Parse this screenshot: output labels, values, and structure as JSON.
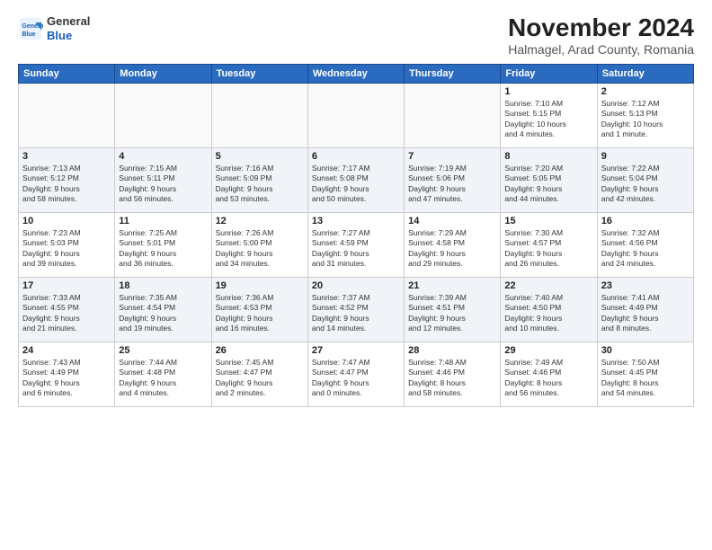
{
  "header": {
    "logo_line1": "General",
    "logo_line2": "Blue",
    "title": "November 2024",
    "subtitle": "Halmagel, Arad County, Romania"
  },
  "weekdays": [
    "Sunday",
    "Monday",
    "Tuesday",
    "Wednesday",
    "Thursday",
    "Friday",
    "Saturday"
  ],
  "weeks": [
    [
      {
        "day": "",
        "info": ""
      },
      {
        "day": "",
        "info": ""
      },
      {
        "day": "",
        "info": ""
      },
      {
        "day": "",
        "info": ""
      },
      {
        "day": "",
        "info": ""
      },
      {
        "day": "1",
        "info": "Sunrise: 7:10 AM\nSunset: 5:15 PM\nDaylight: 10 hours\nand 4 minutes."
      },
      {
        "day": "2",
        "info": "Sunrise: 7:12 AM\nSunset: 5:13 PM\nDaylight: 10 hours\nand 1 minute."
      }
    ],
    [
      {
        "day": "3",
        "info": "Sunrise: 7:13 AM\nSunset: 5:12 PM\nDaylight: 9 hours\nand 58 minutes."
      },
      {
        "day": "4",
        "info": "Sunrise: 7:15 AM\nSunset: 5:11 PM\nDaylight: 9 hours\nand 56 minutes."
      },
      {
        "day": "5",
        "info": "Sunrise: 7:16 AM\nSunset: 5:09 PM\nDaylight: 9 hours\nand 53 minutes."
      },
      {
        "day": "6",
        "info": "Sunrise: 7:17 AM\nSunset: 5:08 PM\nDaylight: 9 hours\nand 50 minutes."
      },
      {
        "day": "7",
        "info": "Sunrise: 7:19 AM\nSunset: 5:06 PM\nDaylight: 9 hours\nand 47 minutes."
      },
      {
        "day": "8",
        "info": "Sunrise: 7:20 AM\nSunset: 5:05 PM\nDaylight: 9 hours\nand 44 minutes."
      },
      {
        "day": "9",
        "info": "Sunrise: 7:22 AM\nSunset: 5:04 PM\nDaylight: 9 hours\nand 42 minutes."
      }
    ],
    [
      {
        "day": "10",
        "info": "Sunrise: 7:23 AM\nSunset: 5:03 PM\nDaylight: 9 hours\nand 39 minutes."
      },
      {
        "day": "11",
        "info": "Sunrise: 7:25 AM\nSunset: 5:01 PM\nDaylight: 9 hours\nand 36 minutes."
      },
      {
        "day": "12",
        "info": "Sunrise: 7:26 AM\nSunset: 5:00 PM\nDaylight: 9 hours\nand 34 minutes."
      },
      {
        "day": "13",
        "info": "Sunrise: 7:27 AM\nSunset: 4:59 PM\nDaylight: 9 hours\nand 31 minutes."
      },
      {
        "day": "14",
        "info": "Sunrise: 7:29 AM\nSunset: 4:58 PM\nDaylight: 9 hours\nand 29 minutes."
      },
      {
        "day": "15",
        "info": "Sunrise: 7:30 AM\nSunset: 4:57 PM\nDaylight: 9 hours\nand 26 minutes."
      },
      {
        "day": "16",
        "info": "Sunrise: 7:32 AM\nSunset: 4:56 PM\nDaylight: 9 hours\nand 24 minutes."
      }
    ],
    [
      {
        "day": "17",
        "info": "Sunrise: 7:33 AM\nSunset: 4:55 PM\nDaylight: 9 hours\nand 21 minutes."
      },
      {
        "day": "18",
        "info": "Sunrise: 7:35 AM\nSunset: 4:54 PM\nDaylight: 9 hours\nand 19 minutes."
      },
      {
        "day": "19",
        "info": "Sunrise: 7:36 AM\nSunset: 4:53 PM\nDaylight: 9 hours\nand 16 minutes."
      },
      {
        "day": "20",
        "info": "Sunrise: 7:37 AM\nSunset: 4:52 PM\nDaylight: 9 hours\nand 14 minutes."
      },
      {
        "day": "21",
        "info": "Sunrise: 7:39 AM\nSunset: 4:51 PM\nDaylight: 9 hours\nand 12 minutes."
      },
      {
        "day": "22",
        "info": "Sunrise: 7:40 AM\nSunset: 4:50 PM\nDaylight: 9 hours\nand 10 minutes."
      },
      {
        "day": "23",
        "info": "Sunrise: 7:41 AM\nSunset: 4:49 PM\nDaylight: 9 hours\nand 8 minutes."
      }
    ],
    [
      {
        "day": "24",
        "info": "Sunrise: 7:43 AM\nSunset: 4:49 PM\nDaylight: 9 hours\nand 6 minutes."
      },
      {
        "day": "25",
        "info": "Sunrise: 7:44 AM\nSunset: 4:48 PM\nDaylight: 9 hours\nand 4 minutes."
      },
      {
        "day": "26",
        "info": "Sunrise: 7:45 AM\nSunset: 4:47 PM\nDaylight: 9 hours\nand 2 minutes."
      },
      {
        "day": "27",
        "info": "Sunrise: 7:47 AM\nSunset: 4:47 PM\nDaylight: 9 hours\nand 0 minutes."
      },
      {
        "day": "28",
        "info": "Sunrise: 7:48 AM\nSunset: 4:46 PM\nDaylight: 8 hours\nand 58 minutes."
      },
      {
        "day": "29",
        "info": "Sunrise: 7:49 AM\nSunset: 4:46 PM\nDaylight: 8 hours\nand 56 minutes."
      },
      {
        "day": "30",
        "info": "Sunrise: 7:50 AM\nSunset: 4:45 PM\nDaylight: 8 hours\nand 54 minutes."
      }
    ]
  ]
}
